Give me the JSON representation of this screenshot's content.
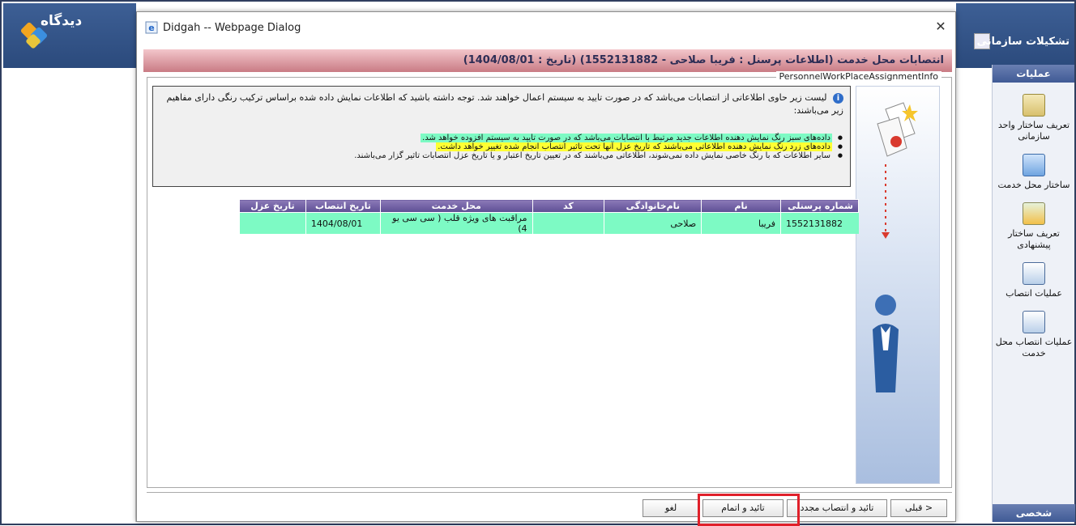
{
  "left_app": {
    "logo_text": "دیدگاه"
  },
  "right_app": {
    "title": "تشکیلات سازمانی",
    "panel_header": "عملیات",
    "panel_footer": "شخصی",
    "items": [
      {
        "label": "تعریف ساختار واحد سازمانی",
        "icon": "building-icon"
      },
      {
        "label": "ساختار محل خدمت",
        "icon": "org-structure-icon"
      },
      {
        "label": "تعریف ساختار پیشنهادی",
        "icon": "proposed-structure-icon"
      },
      {
        "label": "عملیات انتصاب",
        "icon": "assignment-icon"
      },
      {
        "label": "عملیات انتصاب محل خدمت",
        "icon": "workplace-assignment-icon"
      }
    ]
  },
  "dialog": {
    "title": "Didgah -- Webpage Dialog",
    "close_symbol": "✕",
    "header": "انتصابات محل خدمت (اطلاعات پرسنل : فریبا صلاحی - 1552131882) (تاریخ : 1404/08/01)",
    "legend": "PersonnelWorkPlaceAssignmentInfo",
    "info_text": "لیست زیر حاوی اطلاعاتی از انتصابات می‌باشد که در صورت تایید به سیستم اعمال خواهند شد. توجه داشته باشید که اطلاعات نمایش داده شده براساس ترکیب رنگی دارای مفاهیم زیر می‌باشند:",
    "bullets": [
      "داده‌های سبز رنگ نمایش دهنده اطلاعات جدید مرتبط با انتصابات می‌باشد که در صورت تایید به سیستم افزوده خواهد شد.",
      "داده‌های زرد رنگ نمایش دهنده اطلاعاتی می‌باشند که تاریخ عزل آنها تحت تاثیر انتصاب انجام شده تغییر خواهد داشت.",
      "سایر اطلاعات که با رنگ خاصی نمایش داده نمی‌شوند، اطلاعاتی می‌باشند که در تعیین تاریخ اعتبار و یا تاریخ عزل انتصابات تاثیر گزار می‌باشند."
    ],
    "table": {
      "columns": [
        "شماره پرسنلی",
        "نام",
        "نام‌خانوادگی",
        "کد",
        "محل خدمت",
        "تاریخ انتصاب",
        "تاریخ عزل"
      ],
      "rows": [
        [
          "1552131882",
          "فریبا",
          "صلاحی",
          "",
          "مراقبت های ویژه قلب ( سی سی یو 4)",
          "1404/08/01",
          ""
        ]
      ]
    },
    "buttons": {
      "previous": "< قبلی",
      "confirm_reassign": "تائید و انتصاب مجدد",
      "confirm_finish": "تائید و اتمام",
      "cancel": "لغو"
    }
  }
}
